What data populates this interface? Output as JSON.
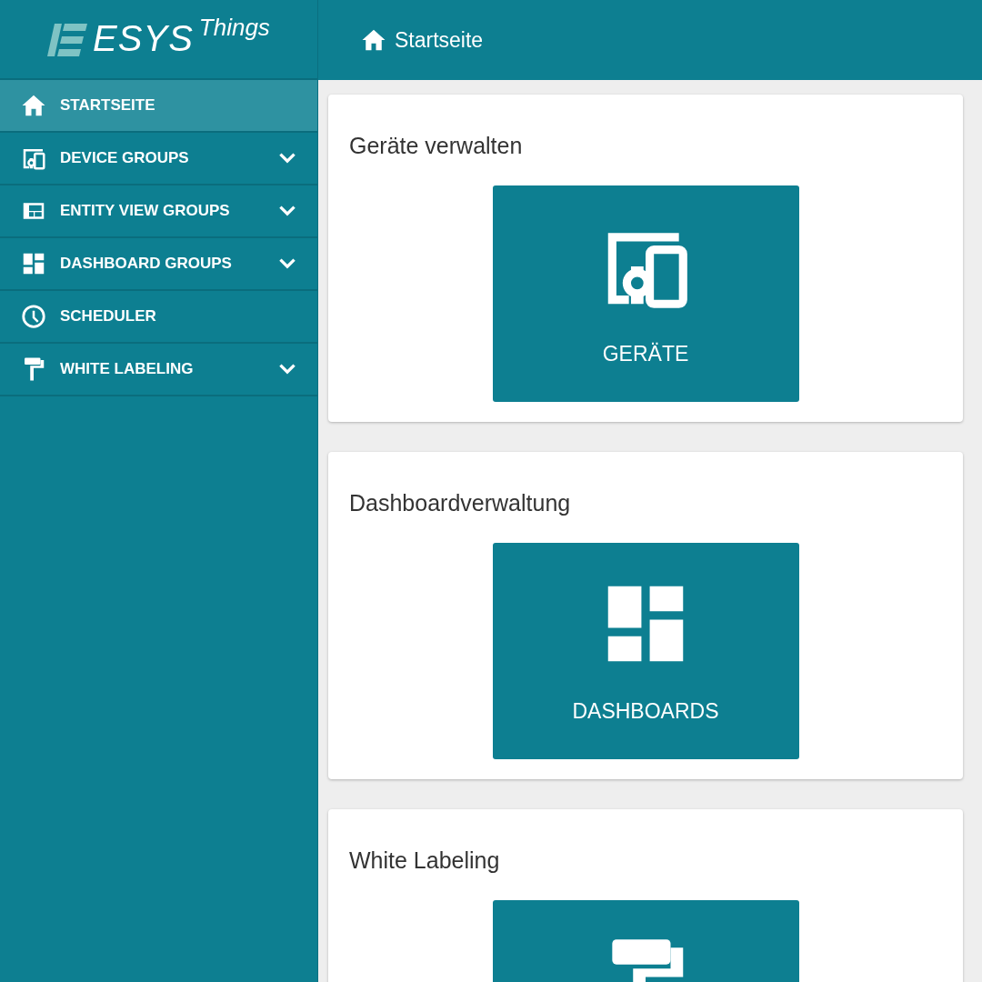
{
  "logo": {
    "brand": "ESYS",
    "suffix": "Things"
  },
  "header": {
    "kind": "home",
    "title": "Startseite"
  },
  "sidebar": {
    "items": [
      {
        "label": "STARTSEITE",
        "kind": "home",
        "selected": true,
        "expandable": false
      },
      {
        "label": "DEVICE GROUPS",
        "kind": "devices",
        "selected": false,
        "expandable": true
      },
      {
        "label": "ENTITY VIEW GROUPS",
        "kind": "entity",
        "selected": false,
        "expandable": true
      },
      {
        "label": "DASHBOARD GROUPS",
        "kind": "dashboard",
        "selected": false,
        "expandable": true
      },
      {
        "label": "SCHEDULER",
        "kind": "clock",
        "selected": false,
        "expandable": false
      },
      {
        "label": "WHITE LABELING",
        "kind": "roller",
        "selected": false,
        "expandable": true
      }
    ]
  },
  "sections": [
    {
      "title": "Geräte verwalten",
      "tile": {
        "kind": "devices",
        "label": "GERÄTE"
      }
    },
    {
      "title": "Dashboardverwaltung",
      "tile": {
        "kind": "dashboard",
        "label": "DASHBOARDS"
      }
    },
    {
      "title": "White Labeling",
      "tile": {
        "kind": "roller"
      }
    }
  ]
}
